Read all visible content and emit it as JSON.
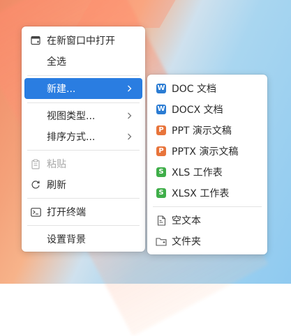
{
  "main_menu": {
    "items": [
      {
        "label": "在新窗口中打开",
        "icon": "new-window-icon"
      },
      {
        "label": "全选"
      },
      {
        "label": "新建...",
        "highlighted": true,
        "has_submenu": true
      },
      {
        "label": "视图类型...",
        "has_submenu": true
      },
      {
        "label": "排序方式...",
        "has_submenu": true
      },
      {
        "label": "粘贴",
        "icon": "clipboard-icon",
        "disabled": true
      },
      {
        "label": "刷新",
        "icon": "refresh-icon"
      },
      {
        "label": "打开终端",
        "icon": "terminal-icon"
      },
      {
        "label": "设置背景"
      }
    ]
  },
  "sub_menu": {
    "items": [
      {
        "label": "DOC 文档",
        "icon": "word-doc-icon",
        "badge": "W",
        "color": "#2b7cd3"
      },
      {
        "label": "DOCX 文档",
        "icon": "word-docx-icon",
        "badge": "W",
        "color": "#2b7cd3"
      },
      {
        "label": "PPT 演示文稿",
        "icon": "ppt-icon",
        "badge": "P",
        "color": "#e8743b"
      },
      {
        "label": "PPTX 演示文稿",
        "icon": "pptx-icon",
        "badge": "P",
        "color": "#e8743b"
      },
      {
        "label": "XLS 工作表",
        "icon": "xls-icon",
        "badge": "S",
        "color": "#3fae49"
      },
      {
        "label": "XLSX 工作表",
        "icon": "xlsx-icon",
        "badge": "S",
        "color": "#3fae49"
      },
      {
        "label": "空文本",
        "icon": "empty-text-file-icon"
      },
      {
        "label": "文件夹",
        "icon": "folder-icon"
      }
    ]
  },
  "colors": {
    "highlight": "#2a7de1",
    "menu_bg": "#ffffff",
    "disabled_text": "#a8a8a8"
  }
}
